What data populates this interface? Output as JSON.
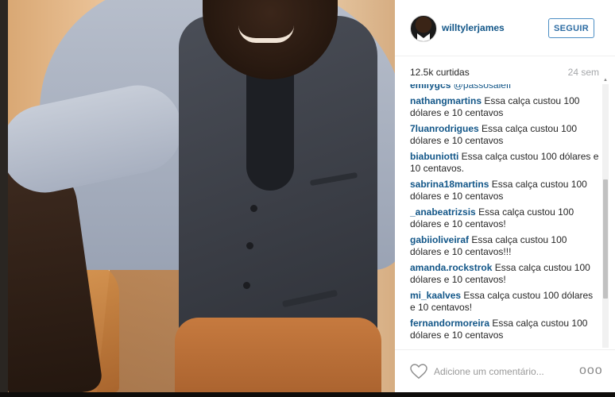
{
  "post": {
    "username": "willtylerjames",
    "follow_label": "SEGUIR",
    "likes": "12.5k curtidas",
    "time_ago": "24 sem"
  },
  "comments": [
    {
      "user": "emilygcs",
      "text": "",
      "mention": "@passosaleff"
    },
    {
      "user": "nathangmartins",
      "text": "Essa calça custou 100 dólares e 10 centavos"
    },
    {
      "user": "7luanrodrigues",
      "text": "Essa calça custou 100 dólares e 10 centavos"
    },
    {
      "user": "biabuniotti",
      "text": "Essa calça custou 100 dólares e 10 centavos."
    },
    {
      "user": "sabrina18martins",
      "text": "Essa calça custou 100 dólares e 10 centavos"
    },
    {
      "user": "_anabeatrizsis",
      "text": "Essa calça custou 100 dólares e 10 centavos!"
    },
    {
      "user": "gabiioliveiraf",
      "text": "Essa calça custou 100 dólares e 10 centavos!!!"
    },
    {
      "user": "amanda.rockstrok",
      "text": "Essa calça custou 100 dólares e 10 centavos!"
    },
    {
      "user": "mi_kaalves",
      "text": "Essa calça custou 100 dólares e 10 centavos!"
    },
    {
      "user": "fernandormoreira",
      "text": "Essa calça custou 100 dólares e 10 centavos"
    }
  ],
  "footer": {
    "comment_placeholder": "Adicione um comentário...",
    "more_label": "ooo"
  },
  "icons": {
    "like": "heart-outline-icon",
    "more": "more-options-icon"
  },
  "colors": {
    "link": "#125688",
    "follow_border": "#4c8ec4",
    "muted": "#a5a7aa"
  }
}
